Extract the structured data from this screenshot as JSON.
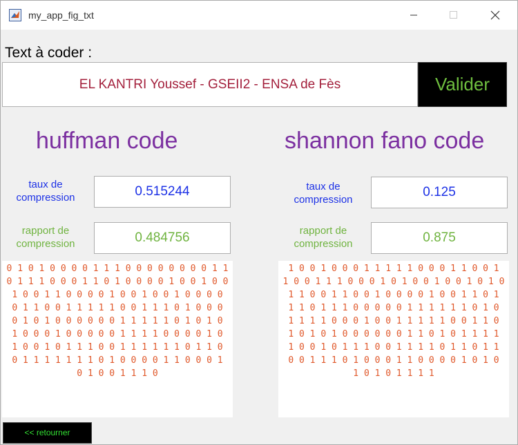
{
  "window": {
    "title": "my_app_fig_txt",
    "app_icon": "matlab-icon",
    "controls": [
      "minimize-icon",
      "maximize-icon",
      "close-icon"
    ]
  },
  "input": {
    "label": "Text à coder :",
    "value": "EL KANTRI Youssef - GSEII2 - ENSA de Fès",
    "submit_label": "Valider"
  },
  "huffman": {
    "title": "huffman code",
    "taux_label": [
      "taux de",
      "compression"
    ],
    "taux_value": "0.515244",
    "rapport_label": [
      "rapport de",
      "compression"
    ],
    "rapport_value": "0.484756",
    "code_lines": [
      "0 1 0 1 0 0 0 0 1 1 1 0 0 0 0 0 0 0 0 1 1",
      "0 1 1 1 0 0 0 1 1 0 1 0 0 0 0 1 0 0 1 0 0",
      "1 0 0 1 1 0 0 0 0 1 0 0 1 0 0 1 0 0 0 0",
      "0 1 1 0 0 1 1 1 1 1 0 0 1 1 1 0 1 0 0 0",
      "0 1 0 1 0 0 0 0 0 0 1 1 1 1 1 0 1 0 1 0",
      "1 0 0 0 1 0 0 0 0 0 1 1 1 1 0 0 0 0 1 0",
      "1 0 0 1 0 1 1 1 0 0 1 1 1 1 1 1 0 1 1 0",
      "0 1 1 1 1 1 1 1 0 1 0 0 0 0 1 1 0 0 0 1",
      "0 1 0 0 1 1 1 0"
    ]
  },
  "shannon": {
    "title": "shannon fano code",
    "taux_label": [
      "taux de",
      "compression"
    ],
    "taux_value": "0.125",
    "rapport_label": [
      "rapport de",
      "compression"
    ],
    "rapport_value": "0.875",
    "code_lines": [
      "1 0 0 1 0 0 0 1 1 1 1 1 0 0 0 1 1 0 0 1",
      "1 0 0 1 1 1 0 0 0 1 0 1 0 0 1 0 0 1 0 1 0",
      "1 1 0 0 1 1 0 0 1 0 0 0 0 1 0 0 1 1 0 1",
      "1 1 0 1 1 1 0 0 0 0 0 1 1 1 1 1 1 0 1 0",
      "1 1 1 1 0 0 0 1 0 0 1 1 1 1 1 0 0 1 1 0",
      "1 0 1 0 1 0 0 0 0 0 0 1 1 0 1 0 1 1 1 1",
      "1 0 0 1 0 1 1 1 0 0 1 1 1 1 0 1 1 0 1 1",
      "0 0 1 1 1 0 1 0 0 0 1 1 0 0 0 0 1 0 1 0",
      "1 0 1 0 1 1 1 1"
    ]
  },
  "back_button": {
    "label": "<< retourner"
  }
}
